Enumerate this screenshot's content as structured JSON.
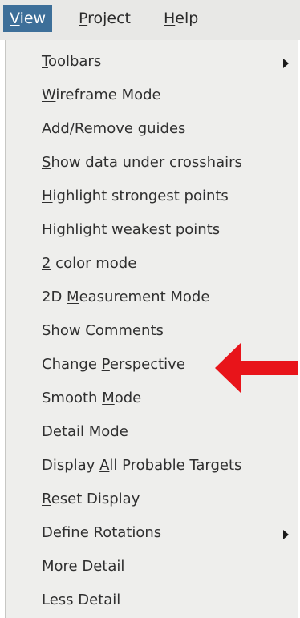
{
  "menubar": {
    "items": [
      {
        "before": "",
        "u": "V",
        "after": "iew",
        "active": true
      },
      {
        "before": "",
        "u": "P",
        "after": "roject",
        "active": false
      },
      {
        "before": "",
        "u": "H",
        "after": "elp",
        "active": false
      }
    ]
  },
  "view_menu": {
    "items": [
      {
        "before": "",
        "u": "T",
        "after": "oolbars",
        "submenu": true
      },
      {
        "before": "",
        "u": "W",
        "after": "ireframe Mode",
        "submenu": false
      },
      {
        "before": "Add/Remove ",
        "u": "g",
        "after": "uides",
        "submenu": false
      },
      {
        "before": "",
        "u": "S",
        "after": "how data under crosshairs",
        "submenu": false
      },
      {
        "before": "",
        "u": "H",
        "after": "ighlight strongest points",
        "submenu": false
      },
      {
        "before": "Hi",
        "u": "g",
        "after": "hlight weakest points",
        "submenu": false
      },
      {
        "before": "",
        "u": "2",
        "after": " color mode",
        "submenu": false
      },
      {
        "before": "2D ",
        "u": "M",
        "after": "easurement Mode",
        "submenu": false
      },
      {
        "before": "Show ",
        "u": "C",
        "after": "omments",
        "submenu": false
      },
      {
        "before": "Change ",
        "u": "P",
        "after": "erspective",
        "submenu": false
      },
      {
        "before": "Smooth ",
        "u": "M",
        "after": "ode",
        "submenu": false
      },
      {
        "before": "D",
        "u": "e",
        "after": "tail Mode",
        "submenu": false
      },
      {
        "before": "Display ",
        "u": "A",
        "after": "ll Probable Targets",
        "submenu": false
      },
      {
        "before": "",
        "u": "R",
        "after": "eset Display",
        "submenu": false
      },
      {
        "before": "",
        "u": "D",
        "after": "efine Rotations",
        "submenu": true
      },
      {
        "before": "More Detail",
        "u": "",
        "after": "",
        "submenu": false
      },
      {
        "before": "Less Detail",
        "u": "",
        "after": "",
        "submenu": false
      }
    ]
  },
  "annotation": {
    "arrow_color": "#e8141a",
    "points_to": "Change Perspective"
  },
  "colors": {
    "menubar_bg": "#e8e8e6",
    "active_menu_bg": "#3d6f99",
    "menu_bg": "#eeeeec"
  }
}
